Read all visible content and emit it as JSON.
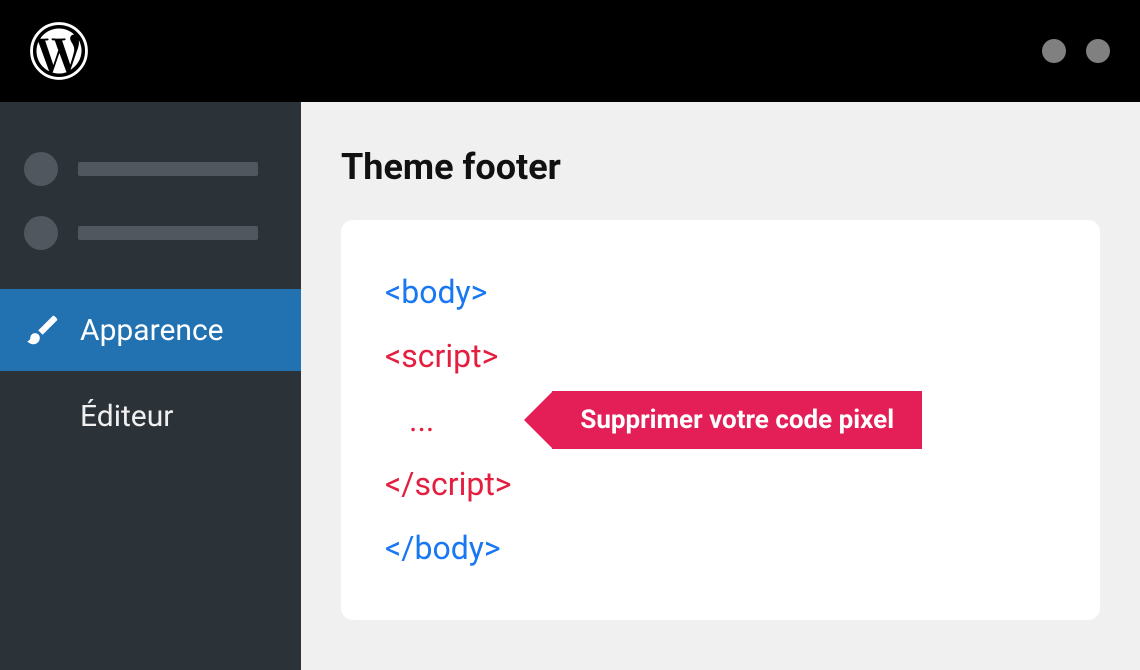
{
  "sidebar": {
    "appearance_label": "Apparence",
    "editor_label": "Éditeur"
  },
  "main": {
    "title": "Theme footer",
    "code": {
      "body_open": "<body>",
      "script_open": "<script>",
      "ellipsis": "...",
      "script_close": "</script>",
      "body_close": "</body>"
    },
    "callout": "Supprimer votre code pixel"
  }
}
